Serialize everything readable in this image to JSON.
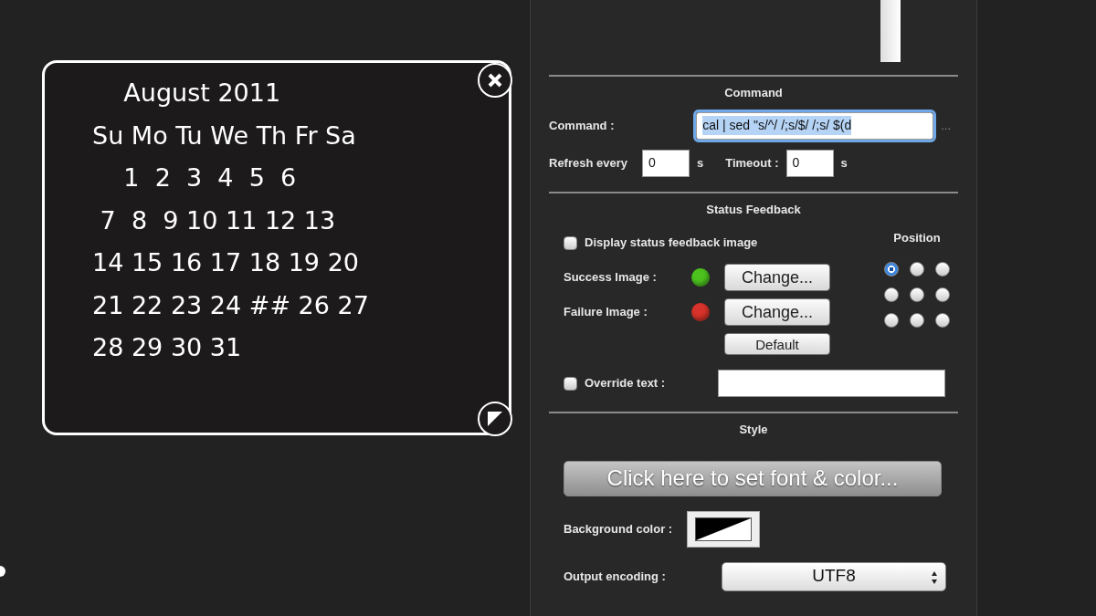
{
  "calendar_widget": {
    "lines": [
      "    August 2011",
      "Su Mo Tu We Th Fr Sa",
      "    1  2  3  4  5  6",
      " 7  8  9 10 11 12 13",
      "14 15 16 17 18 19 20",
      "21 22 23 24 ## 26 27",
      "28 29 30 31"
    ]
  },
  "command_section": {
    "title": "Command",
    "command_label": "Command :",
    "command_value": "cal | sed \"s/^/ /;s/$/ /;s/ $(d",
    "command_focused": true,
    "more_button": "...",
    "refresh_label": "Refresh every",
    "refresh_value": "0",
    "refresh_unit": "s",
    "timeout_label": "Timeout :",
    "timeout_value": "0",
    "timeout_unit": "s"
  },
  "status_feedback": {
    "title": "Status Feedback",
    "display_image": {
      "label": "Display status feedback image",
      "checked": false
    },
    "images": [
      {
        "label": "Success Image :",
        "color": "#4cc21e",
        "button": "Change..."
      },
      {
        "label": "Failure Image :",
        "color": "#d8332a",
        "button": "Change..."
      }
    ],
    "default_button": "Default",
    "position": {
      "title": "Position",
      "options": [
        {
          "selected": true
        },
        {
          "selected": false
        },
        {
          "selected": false
        },
        {
          "selected": false
        },
        {
          "selected": false
        },
        {
          "selected": false
        },
        {
          "selected": false
        },
        {
          "selected": false
        },
        {
          "selected": false
        }
      ]
    },
    "override_text": {
      "label": "Override text :",
      "checked": false
    }
  },
  "style_section": {
    "title": "Style",
    "font_button": "Click here to set font & color...",
    "background_label": "Background color :",
    "encoding_label": "Output encoding :",
    "encoding_value": "UTF8"
  }
}
